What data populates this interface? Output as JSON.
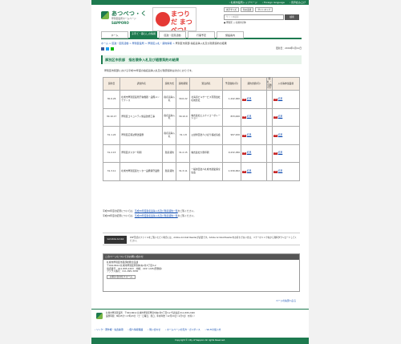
{
  "topbar": {
    "home": "› 札幌市役所トップページ",
    "foreign": "› Foreign language",
    "about": "› 音声読み上げ"
  },
  "logo": {
    "name": "あつべつ・く",
    "sub": "厚別区役所ホームページ",
    "sapporo": "SAPPORO"
  },
  "banner": {
    "text": "まつりだ まつべつ!"
  },
  "tools": {
    "font_label": "文字サイズ",
    "color_label": "色の変更",
    "sitemap": "サイトマップ"
  },
  "search": {
    "placeholder": "サイト内検索",
    "button": "検索",
    "opt1": "● 厚別区",
    "opt2": "○ 札幌市全体"
  },
  "nav": {
    "home": "ホーム",
    "kurashi": "子育て・暮らしの情報",
    "kusei": "区政・区民活動",
    "event": "行事予定",
    "shisetsu": "施設案内"
  },
  "breadcrumb": {
    "home": "ホーム",
    "kusei": "区政・区民活動",
    "kuyakusho": "厚別区役所",
    "nyusatsu": "厚別区入札・契約情報",
    "current": "厚別区市民部 指名競争入札及び随意契約の結果"
  },
  "page": {
    "updated": "更新日：2019年1月11日",
    "title": "厚別区市民部　指名競争入札及び随意契約の結果",
    "lead": "厚別区市民部における平成30年度の指名競争入札及び随意契約は次のとおりです。"
  },
  "table": {
    "headers": [
      "契約日",
      "調達件名",
      "契約方式",
      "契約期間",
      "受注者名",
      "予定価格(円)",
      "契約金額(円)",
      "開札・見積(円)",
      "入札等参加業者"
    ],
    "rows": [
      {
        "date": "30.6.26",
        "name": "札幌市厚別区役所庁舎機器・設備メンテナンス",
        "method": "指名競争入札",
        "period": "30.6.22",
        "vendor": "北海道ビルサービス有限会社札幌支社",
        "price": "1,242,000",
        "link1": "結果",
        "link2": "",
        "link3": "結果"
      },
      {
        "date": "30.10.17",
        "name": "厚別区コミュニティ施設改修工事",
        "method": "指名競争入札",
        "period": "30.10.9",
        "vendor": "株式会社エムケイコーポレーション",
        "price": "833,000",
        "link1": "結果",
        "link2": "",
        "link3": "結果"
      },
      {
        "date": "31.1.24",
        "name": "厚別区広報誌発送業務",
        "method": "指名競争入札",
        "period": "31.1.8",
        "vendor": "公益財団法人ひばり福祉協会",
        "price": "997,200",
        "link1": "結果",
        "link2": "",
        "link3": "結果"
      },
      {
        "date": "31.2.15",
        "name": "厚別区ポスター印刷",
        "method": "随意契約",
        "period": "31.2.15",
        "vendor": "株式会社大豊印刷",
        "price": "9,232,056",
        "link1": "結果",
        "link2": "",
        "link3": "結果"
      },
      {
        "date": "31.3.11",
        "name": "札幌市厚別区民センター設備保守業務",
        "method": "随意契約",
        "period": "31.3.11",
        "vendor": "一般財団法人札幌市建築保全協会",
        "price": "1,530,652",
        "link1": "結果",
        "link2": "",
        "link3": "結果"
      }
    ]
  },
  "notes": {
    "n1_pre": "平成30年度の結果については、",
    "n1_link": "平成30年度指名競争入札及び随意契約一覧",
    "n1_post": "をご覧ください。",
    "n2_pre": "平成29年度の結果については、",
    "n2_link": "平成29年度指名競争入札及び随意契約一覧",
    "n2_post": "をご覧ください。"
  },
  "reader": {
    "button": "Get Adobe Acrobat Reader",
    "text": "PDF形式のファイルをご覧いただく場合には、Adobe Acrobat Readerが必要です。Adobe Acrobat Readerをお持ちでない方は、バナーのリンク先から無料ダウンロードしてください。"
  },
  "contact": {
    "heading": "このページについてのお問い合わせ",
    "org": "札幌市厚別区市民部総務企画課",
    "addr": "〒004-8612 札幌市厚別区厚別中央1条5丁目3-2",
    "tel": "電話番号：011-895-2403　内線：222～225(庶務係)",
    "fax": "ファクス番号：011-895-3030",
    "form": "お問い合わせフォーム"
  },
  "pagetop": "ページの先頭へ戻る",
  "footer": {
    "office": "札幌市厚別区役所　〒004-8612 札幌市厚別区厚別中央1条5丁目3-2 代表電話 011-895-2400",
    "hours": "業務時間：8時45分～17時15分（土・日曜日、祝日、年末年始（12月29日～1月3日）を除く）",
    "links": [
      "› リンク・著作権・免責事項",
      "› 個人情報保護",
      "› 問い合わせ",
      "› ホームページの見方・ガイダンス",
      "› Wi-Fiの使い方"
    ],
    "copyright": "Copyright © City of Sapporo All rights Reserved."
  }
}
